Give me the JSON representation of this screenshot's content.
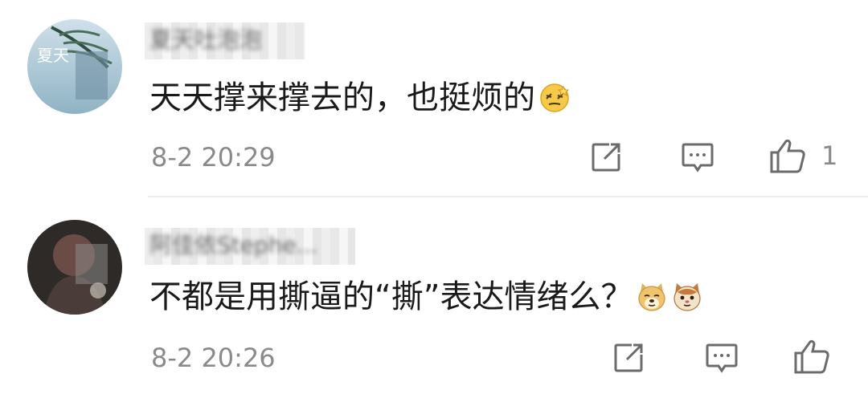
{
  "comments": [
    {
      "username": "夏天吐泡泡",
      "text": "天天撑来撑去的，也挺烦的",
      "emoji": [
        "dizzy-face-icon"
      ],
      "timestamp": "8-2 20:29",
      "likes": "1",
      "avatar_icon": "avatar-summer-photo",
      "avatar_text": "夏天"
    },
    {
      "username": "阿佳依Stephe...",
      "text": "不都是用撕逼的“撕”表达情绪么？",
      "emoji": [
        "doge-icon",
        "cat-icon"
      ],
      "timestamp": "8-2 20:26",
      "likes": "",
      "avatar_icon": "avatar-person-photo"
    }
  ],
  "icons": {
    "forward": "forward-icon",
    "reply": "reply-icon",
    "like": "thumbs-up-icon"
  },
  "colors": {
    "text": "#1a1a1a",
    "meta": "#8a8a8a",
    "divider": "#ececec"
  }
}
